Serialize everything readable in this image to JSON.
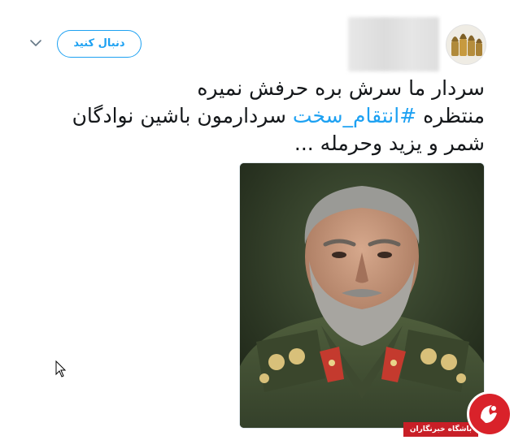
{
  "tweet": {
    "follow_label": "دنبال کنید",
    "text_line1": "سردار ما سرش بره حرفش نمیره",
    "text_line2_prefix": "منتظره ",
    "hashtag": "#انتقام_سخت",
    "text_line2_suffix": " سردارمون باشین نوادگان",
    "text_line3": "شمر و یزید وحرمله ..."
  },
  "watermark": {
    "label": "باشگاه خبرنگاران"
  },
  "icons": {
    "avatar": "bullets-avatar-icon",
    "caret": "chevron-down-icon",
    "cursor": "mouse-pointer-icon"
  },
  "colors": {
    "accent": "#1da1f2",
    "text": "#14171a",
    "watermark_red": "#d9222a"
  }
}
